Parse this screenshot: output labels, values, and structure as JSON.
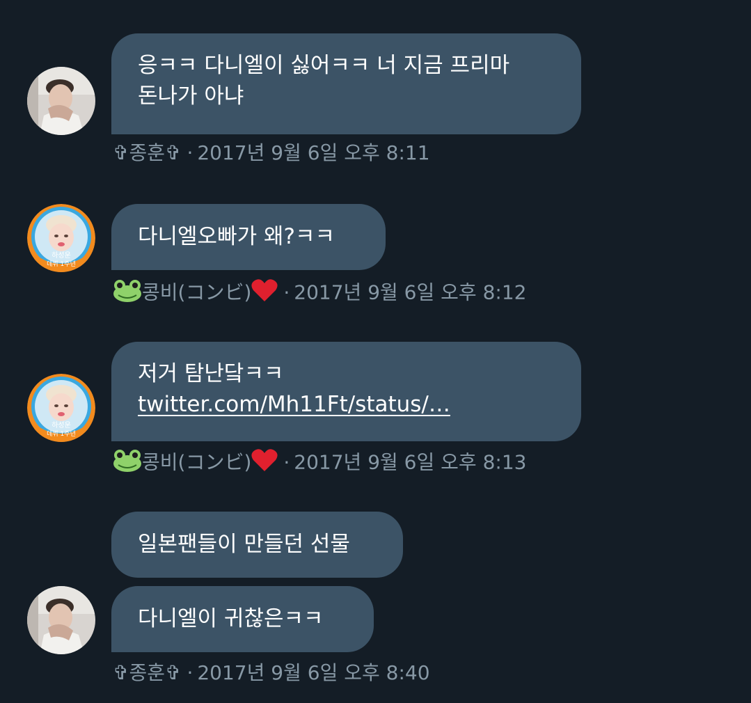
{
  "messages": [
    {
      "sender": "jonghoon",
      "lines": [
        "응ㅋㅋ 다니엘이 싫어ㅋㅋ 너 지금 프리마",
        "돈나가 아냐"
      ]
    },
    {
      "sender": "kongbi",
      "lines": [
        "다니엘오빠가 왜?ㅋㅋ"
      ]
    },
    {
      "sender": "kongbi",
      "lines": [
        "저거 탐난닼ㅋㅋ"
      ],
      "link": "twitter.com/Mh11Ft/status/…"
    },
    {
      "sender": "jonghoon",
      "lines": [
        "일본팬들이 만들던 선물"
      ]
    },
    {
      "sender": "jonghoon",
      "lines": [
        "다니엘이 귀찮은ㅋㅋ"
      ]
    }
  ],
  "meta": [
    {
      "name": "✞종훈✞",
      "timestamp": "2017년 9월 6일 오후 8:11"
    },
    {
      "name": "콩비(コンビ)",
      "emoji": "frog-and-heart",
      "timestamp": "2017년 9월 6일 오후 8:12"
    },
    {
      "name": "콩비(コンビ)",
      "emoji": "frog-and-heart",
      "timestamp": "2017년 9월 6일 오후 8:13"
    },
    {
      "name": "✞종훈✞",
      "timestamp": "2017년 9월 6일 오후 8:40"
    }
  ],
  "separator": "·",
  "avatar_badge": [
    "하성운",
    "데뷔 1주년"
  ],
  "colors": {
    "background": "#141d26",
    "bubble": "#3c5366",
    "meta_text": "#8899a6",
    "badge_orange": "#f28b1e",
    "badge_blue": "#3aa8e0"
  }
}
